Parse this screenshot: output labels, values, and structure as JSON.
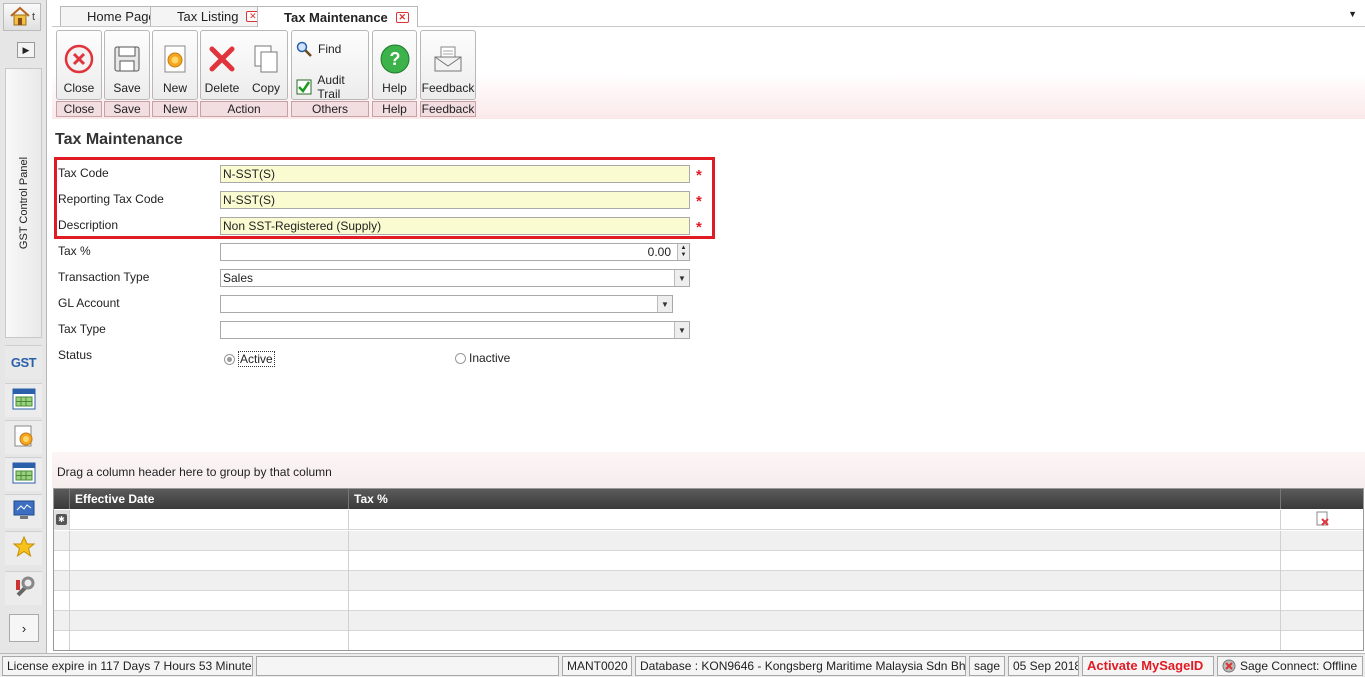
{
  "sidebar": {
    "home_label": "t",
    "panel_title": "GST Control Panel",
    "gst_label": "GST"
  },
  "tabs": {
    "home": "Home Page",
    "tax_listing": "Tax Listing",
    "tax_maintenance": "Tax Maintenance"
  },
  "ribbon": {
    "close": "Close",
    "save": "Save",
    "new": "New",
    "delete": "Delete",
    "copy": "Copy",
    "find": "Find",
    "audit_trail": "Audit Trail",
    "help": "Help",
    "feedback": "Feedback",
    "groups": {
      "close": "Close",
      "save": "Save",
      "new": "New",
      "action": "Action",
      "others": "Others",
      "help": "Help",
      "feedback": "Feedback"
    }
  },
  "form": {
    "title": "Tax Maintenance",
    "tax_code_label": "Tax Code",
    "tax_code_value": "N-SST(S)",
    "reporting_tax_code_label": "Reporting Tax Code",
    "reporting_tax_code_value": "N-SST(S)",
    "description_label": "Description",
    "description_value": "Non SST-Registered (Supply)",
    "tax_pct_label": "Tax %",
    "tax_pct_value": "0.00",
    "transaction_type_label": "Transaction Type",
    "transaction_type_value": "Sales",
    "gl_account_label": "GL Account",
    "gl_account_value": "",
    "tax_type_label": "Tax Type",
    "tax_type_value": "",
    "status_label": "Status",
    "status_active": "Active",
    "status_inactive": "Inactive",
    "status_selected": "Active",
    "required_marker": "*"
  },
  "grid": {
    "group_hint": "Drag a column header here to group by that column",
    "columns": [
      "Effective Date",
      "Tax %"
    ],
    "rows": []
  },
  "statusbar": {
    "license": "License expire in 117 Days 7 Hours 53 Minutes",
    "blank": "",
    "code": "MANT0020",
    "database": "Database : KON9646 - Kongsberg Maritime Malaysia Sdn Bhd",
    "user": "sage",
    "date": "05 Sep 2018",
    "activate": "Activate MySageID",
    "connect": "Sage Connect: Offline"
  },
  "colors": {
    "accent_red": "#e01b23",
    "required_bg": "#fbfbd1",
    "ribbon_group_label": "#f2dde0",
    "grid_header": "#3a3a3a"
  }
}
